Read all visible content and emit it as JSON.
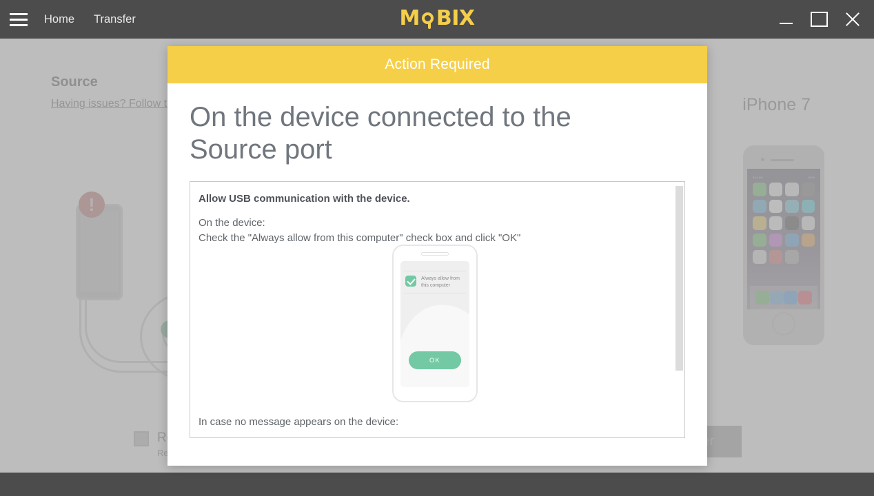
{
  "titlebar": {
    "menu_icon": "hamburger-icon",
    "nav": [
      {
        "label": "Home"
      },
      {
        "label": "Transfer"
      }
    ],
    "brand": {
      "prefix": "M",
      "suffix": "BIX",
      "color": "#f6cf49"
    },
    "window_controls": {
      "minimize": "minimize-icon",
      "maximize": "maximize-icon",
      "close": "close-icon"
    }
  },
  "page": {
    "title": "Source",
    "help_link": "Having issues? Follow these steps",
    "device_name": "iPhone 7",
    "bottom_checkbox": {
      "label": "Retain data on source device",
      "sublabel": "Recommended"
    },
    "transfer_button": "Transfer",
    "phone_status_time": "9:41 AM",
    "phone_status_battery": "100%"
  },
  "modal": {
    "header_title": "Action Required",
    "header_color": "#f6cf49",
    "title": "On the device connected to the Source port",
    "instructions": {
      "heading": "Allow USB communication with the device.",
      "line1": "On the device:",
      "line2": "Check the \"Always allow from this computer\" check box and click \"OK\"",
      "tail": "In case no message appears on the device:"
    },
    "diagram": {
      "checkbox_label": "Always allow from this computer",
      "ok_label": "OK",
      "accent_color": "#72c9a3"
    },
    "scrollbar": {
      "name": "vertical-scrollbar"
    }
  }
}
